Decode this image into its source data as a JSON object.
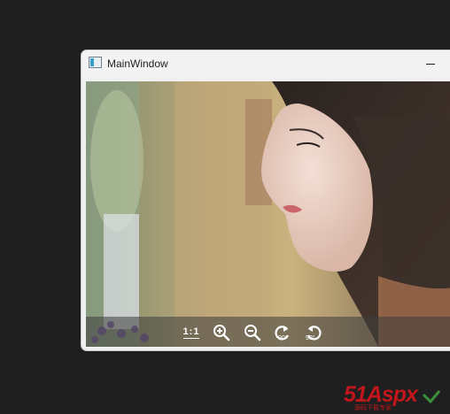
{
  "window": {
    "title": "MainWindow",
    "minimize_glyph": "—"
  },
  "viewer": {
    "image_alt": "portrait photo",
    "toolbar": {
      "actual_size_label": "1:1",
      "zoom_in_icon": "zoom-in-icon",
      "zoom_out_icon": "zoom-out-icon",
      "rotate_right_icon": "rotate-right-icon",
      "rotate_right_label": "90°",
      "rotate_left_icon": "rotate-left-icon",
      "rotate_left_label": "90°"
    }
  },
  "watermark": {
    "brand": "51Aspx",
    "tagline": "源码下载专家"
  },
  "colors": {
    "desktop": "#1f1f1f",
    "titlebar": "#f3f3f3",
    "brand_red": "#c0161c",
    "brand_green": "#3a8f3a"
  }
}
